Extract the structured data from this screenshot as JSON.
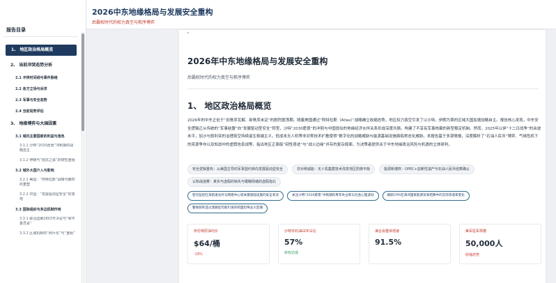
{
  "header": {
    "title": "2026中东地缘格局与发展安全重构",
    "subtitle": "后霸权时代的权力真空与秩序博弈"
  },
  "sidebar": {
    "title": "报告目录",
    "items": [
      {
        "level": 1,
        "label": "1、 地区政治格局概览",
        "active": true
      },
      {
        "level": 1,
        "label": "2、 当前冲突态势分析"
      },
      {
        "level": 2,
        "label": "2.1 冲突时间线与事件脉络"
      },
      {
        "level": 2,
        "label": "2.2 各方立场与诉求"
      },
      {
        "level": 2,
        "label": "2.3 军事与安全态势"
      },
      {
        "level": 2,
        "label": "2.4 当前局势评估"
      },
      {
        "level": 1,
        "label": "3、 地缘博弈与大国因素"
      },
      {
        "level": 2,
        "label": "3.1 域内主要国家的利益与角色",
        "wrap": true
      },
      {
        "level": 3,
        "label": "3.1.1 沙特“2030愿景”冲刺期的战略自主"
      },
      {
        "level": 3,
        "label": "3.1.2 伊朗与“抵抗之弧”的韧性重组"
      },
      {
        "level": 2,
        "label": "3.2 域外大国介入与影响",
        "wrap": true
      },
      {
        "level": 3,
        "label": "3.2.1 美国：“阿特拉斯”战略与霸权的重塑"
      },
      {
        "level": 3,
        "label": "3.2.2 中国：“发展驱动型安全”的落地"
      },
      {
        "level": 2,
        "label": "3.3 国际组织与多边机制作用",
        "wrap": true
      },
      {
        "level": 3,
        "label": "3.3.1 联合国第2803号决议与“和平委员会”"
      },
      {
        "level": 3,
        "label": "3.3.2 区域机制的“碎片化”与“重组”"
      }
    ]
  },
  "document": {
    "title": "2026年中东地缘格局与发展安全重构",
    "subtitle": "后霸权时代的权力真空与秩序博弈",
    "section_title": "1、 地区政治格局概览",
    "paragraph": "2026年的中东正处于“旧秩序瓦解、新秩序未定”的剧烈震荡期。随着美国通过“阿特拉斯（Atlas）”战略确立收缩态势，地区权力真空引发了以沙特、伊朗为首的区域大国加速战略自主。报告核心发现，中东安全逻辑正从传统的“军事结盟”向“发展驱动型安全”转型，沙特“2030愿景”的冲刺与中国提出的地缘经济伙伴关系形成深度共振。构建了不享有军事核霸的新型稳定机制。然而，2025年以伊“十二日战争”的余波未平，加沙与叙利亚的治理真空持续滋生极端主义，低成本无人机等非对称技术扩散使得“数字化的战略威胁与能源基础设施面临常态化威胁。本报告基于多源情报，深度解析了“石油人民币”博弈、气候危机下的资源争夺以及知战中的虚假信息战等，指出地区正面临“韧性奇迹”与“战火边缘”并存的复杂局面，为决策者提供关于中东地缘政治风险与机遇的立体研判。",
    "tags": [
      "安全逻辑重构：从美国主导的军事盟约转向发展驱动型安全",
      "非对称威胁：无人机集群技术改变地区防御平衡",
      "能源新博弈：OPEC+剪断性减产与石油人民币结算确认",
      "认知战迷雾：真实与虚假的缺失与模糊情绪的虚假指北"
    ],
    "notes": [
      "密切监控红海航道光纤与网络中心等关键基础设施的安全状况",
      "关注沙特“2030愿景”冲刺期的青年失业率与社会心理波动",
      "跟踪CIPS在海湾国家能源贸易结算中的实际渗透率变化",
      "警惕叙利亚过渡期后可能引发的跨国恐怖主义回潮"
    ],
    "metrics": [
      {
        "label": "布伦特原油均价",
        "value": "$64/桶",
        "foot": "-18%",
        "foot_color": "#d64545"
      },
      {
        "label": "沙特非石油GDP占比",
        "value": "57%",
        "foot": "目标达成",
        "foot_color": "#2e9e5b"
      },
      {
        "label": "海合会整体增速",
        "value": "91.5%",
        "foot": "",
        "foot_color": "#2e9e5b"
      },
      {
        "label": "美军驻军规模",
        "value": "50,000人",
        "foot": "收缩态势",
        "foot_color": "#d64545"
      }
    ]
  },
  "colors": {
    "accent": "#1e3a5f",
    "highlight": "#c0392b"
  }
}
